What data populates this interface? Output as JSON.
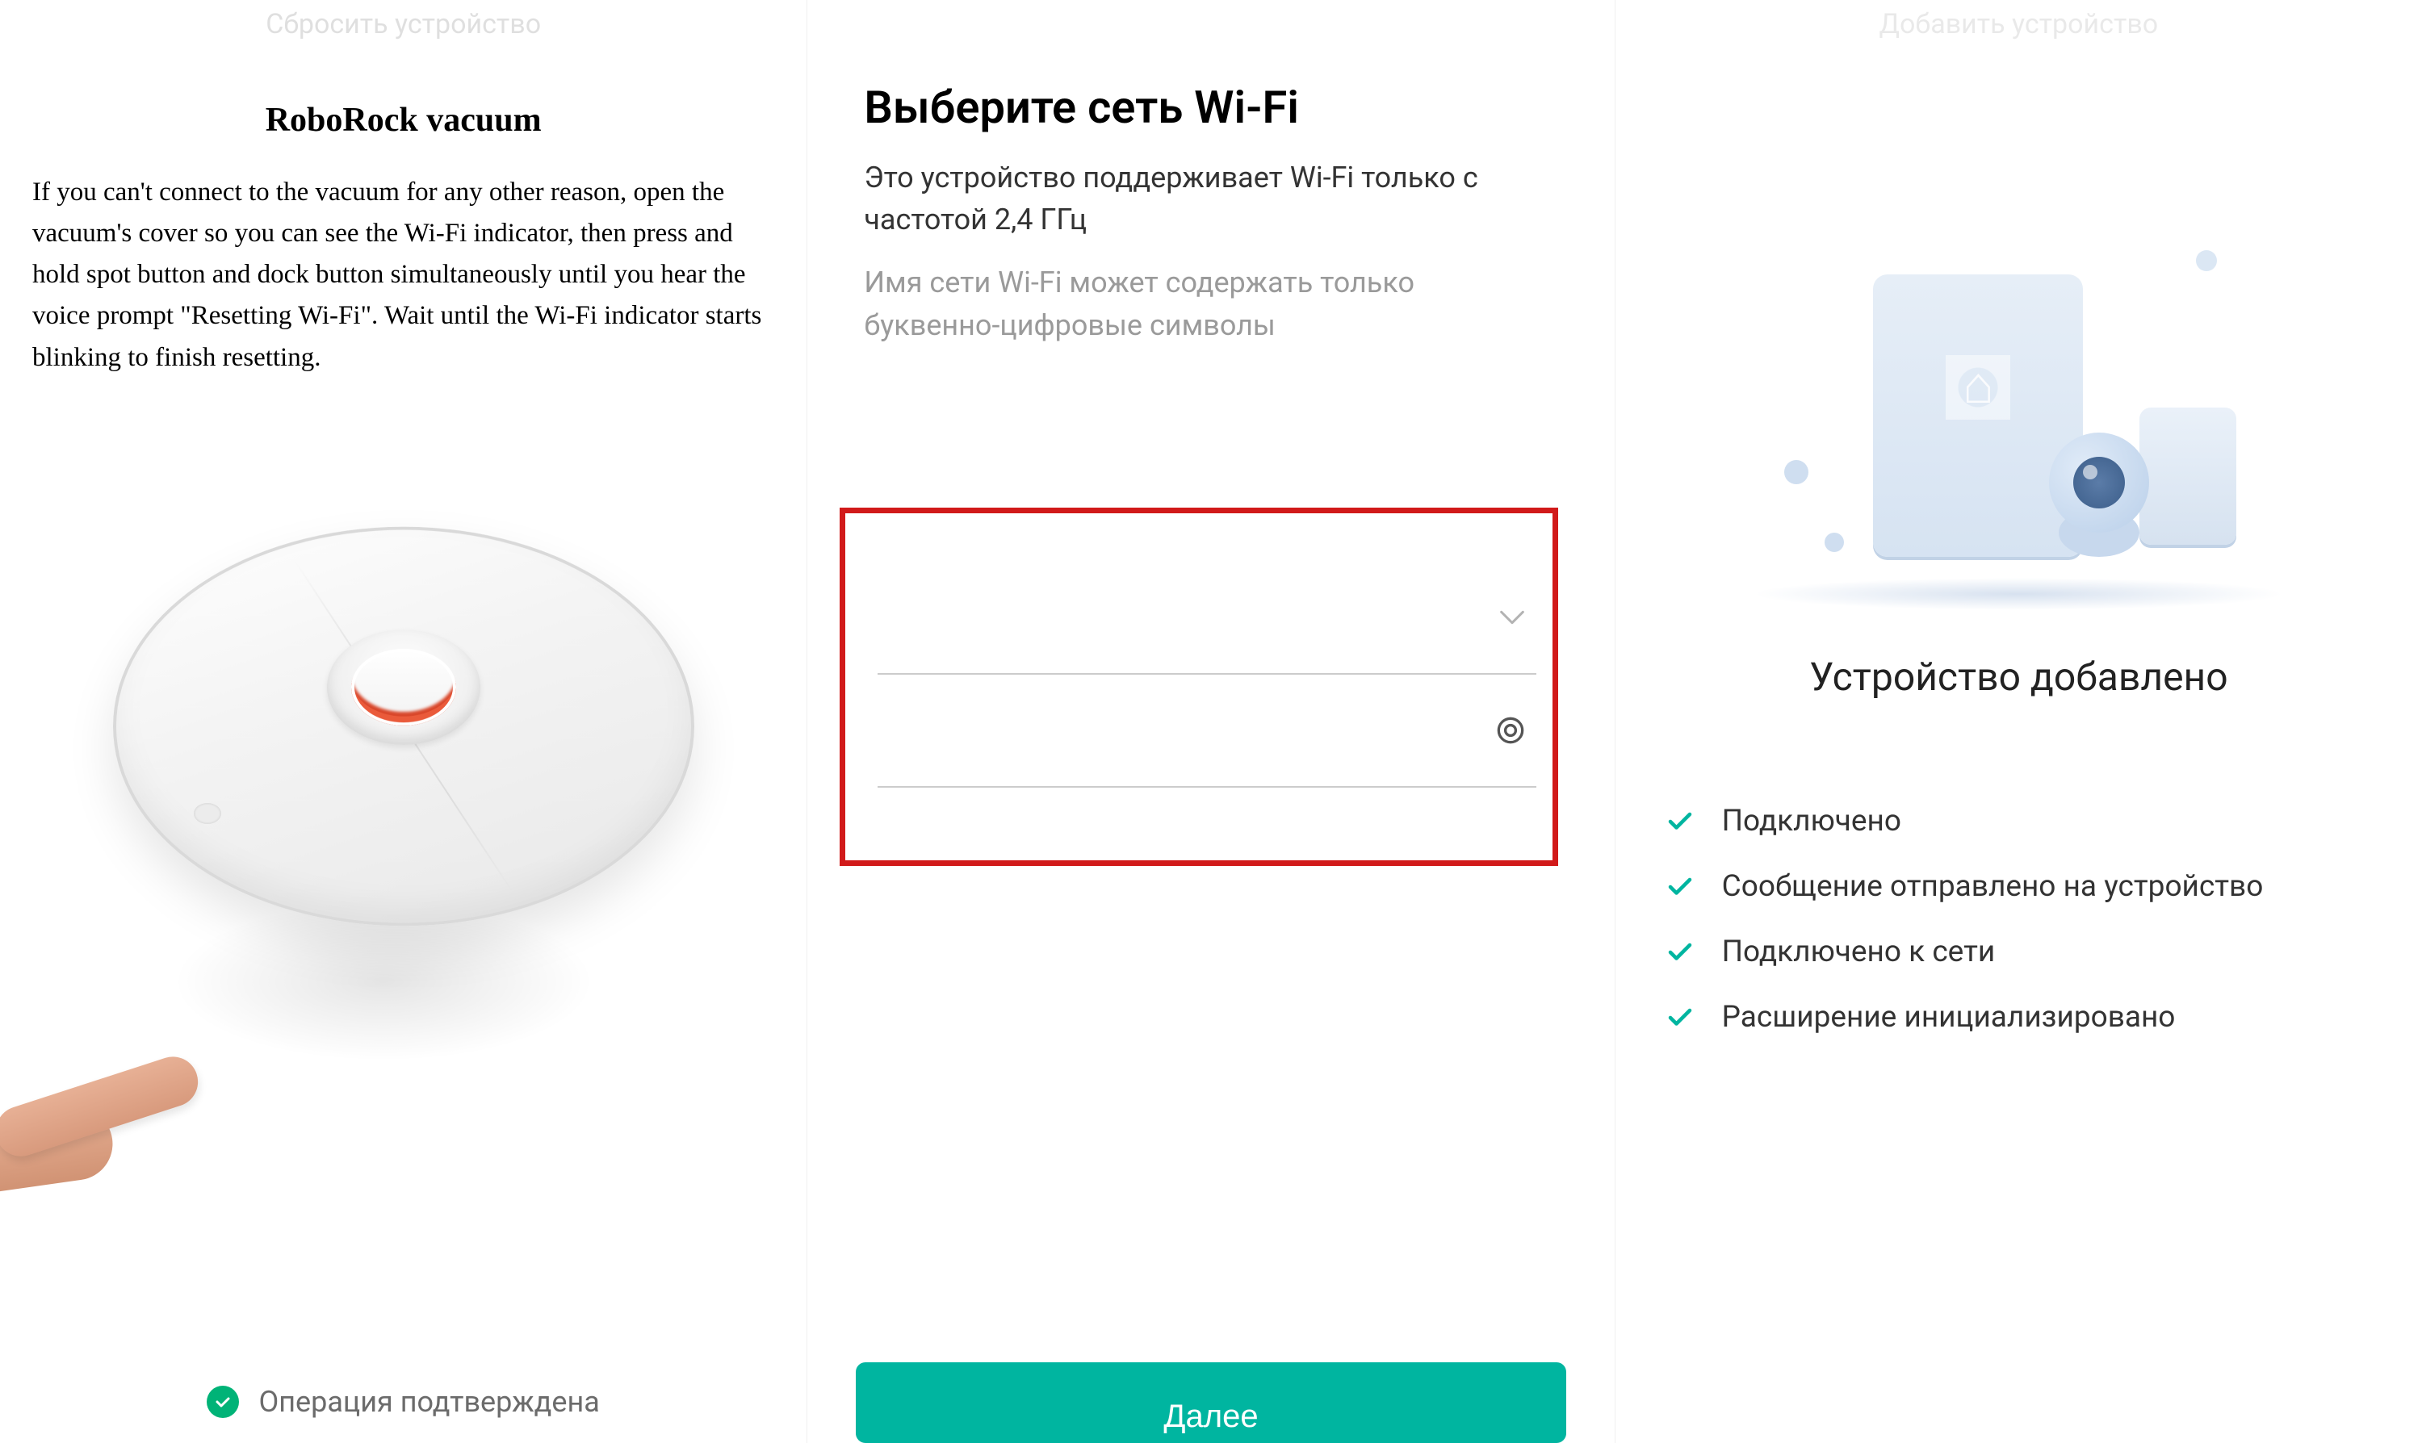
{
  "panel1": {
    "header": "Сбросить устройство",
    "title": "RoboRock vacuum",
    "body": "If you can't connect to the vacuum for any other reason, open the vacuum's cover so you can see the Wi-Fi indicator, then press and hold spot button and dock button simultaneously until you hear the voice prompt \"Resetting Wi-Fi\". Wait until the Wi-Fi indicator starts blinking to finish resetting.",
    "footer_text": "Операция подтверждена"
  },
  "panel2": {
    "title": "Выберите сеть Wi-Fi",
    "sub1": "Это устройство поддерживает Wi-Fi только с частотой 2,4 ГГц",
    "sub2": "Имя сети Wi-Fi может содержать только буквенно-цифровые символы",
    "ssid_placeholder": "",
    "password_placeholder": "",
    "next_label": "Далее"
  },
  "panel3": {
    "header": "Добавить устройство",
    "title": "Устройство добавлено",
    "status": [
      "Подключено",
      "Сообщение отправлено на устройство",
      "Подключено к сети",
      "Расширение инициализировано"
    ]
  },
  "colors": {
    "accent_green": "#00b5a0",
    "check_circle": "#00b377",
    "highlight_red": "#d11a1a"
  }
}
